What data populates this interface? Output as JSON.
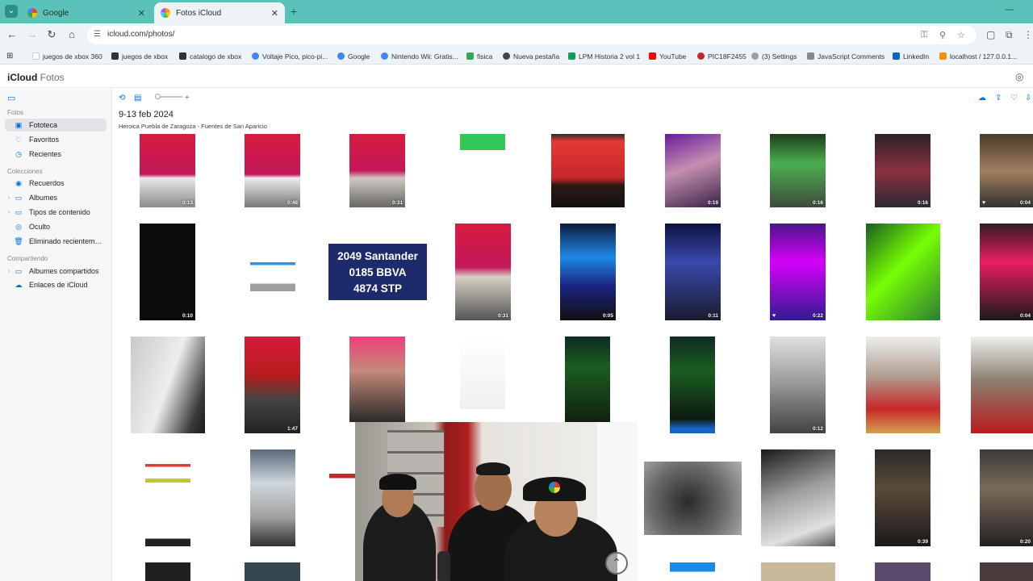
{
  "browser": {
    "tabs": [
      {
        "title": "Google",
        "active": false
      },
      {
        "title": "Fotos iCloud",
        "active": true
      }
    ],
    "url": "icloud.com/photos/",
    "bookmarks": [
      "juegos de xbox 360",
      "juegos de xbox",
      "catalogo de xbox",
      "Voltaje Pico, pico-pi...",
      "Google",
      "Nintendo Wii: Gratis...",
      "fisica",
      "Nueva pestaña",
      "LPM Historia 2 vol 1",
      "YouTube",
      "PIC18F2455",
      "(3) Settings",
      "JavaScript Comments",
      "LinkedIn",
      "localhost / 127.0.0.1..."
    ]
  },
  "app": {
    "brand": "iCloud",
    "brand_sub": "Fotos"
  },
  "sidebar": {
    "section_fotos": "Fotos",
    "fototeca": "Fototeca",
    "favoritos": "Favoritos",
    "recientes": "Recientes",
    "section_colecciones": "Colecciones",
    "recuerdos": "Recuerdos",
    "albumes": "Albumes",
    "tipos": "Tipos de contenido",
    "oculto": "Oculto",
    "eliminado": "Eliminado recientemente",
    "section_compartiendo": "Compartiendo",
    "albumes_compartidos": "Albumes compartidos",
    "enlaces": "Enlaces de iCloud"
  },
  "main": {
    "date_title": "9-13 feb 2024",
    "location": "Heroica Puebla de Zaragoza - Fuentes de San Aparicio",
    "text_card": {
      "line1": "2049 Santander",
      "line2": "0185 BBVA",
      "line3": "4874 STP"
    }
  },
  "durations": {
    "r1c1": "0:13",
    "r1c2": "0:48",
    "r1c3": "0:31",
    "r1c6": "0:19",
    "r1c7": "0:16",
    "r1c8": "0:16",
    "r1c9": "0:04",
    "r2c1": "0:10",
    "r2c4": "0:31",
    "r2c5": "0:05",
    "r2c6": "0:11",
    "r2c7": "0:22",
    "r2c9": "0:04",
    "r3c2": "1:47",
    "r3c7": "0:12",
    "r4c8": "0:39",
    "r4c9": "0:20"
  },
  "colors": {
    "accent": "#0071e3",
    "tabstrip": "#5ac2b8",
    "text_card_bg": "#1d2a6b"
  }
}
